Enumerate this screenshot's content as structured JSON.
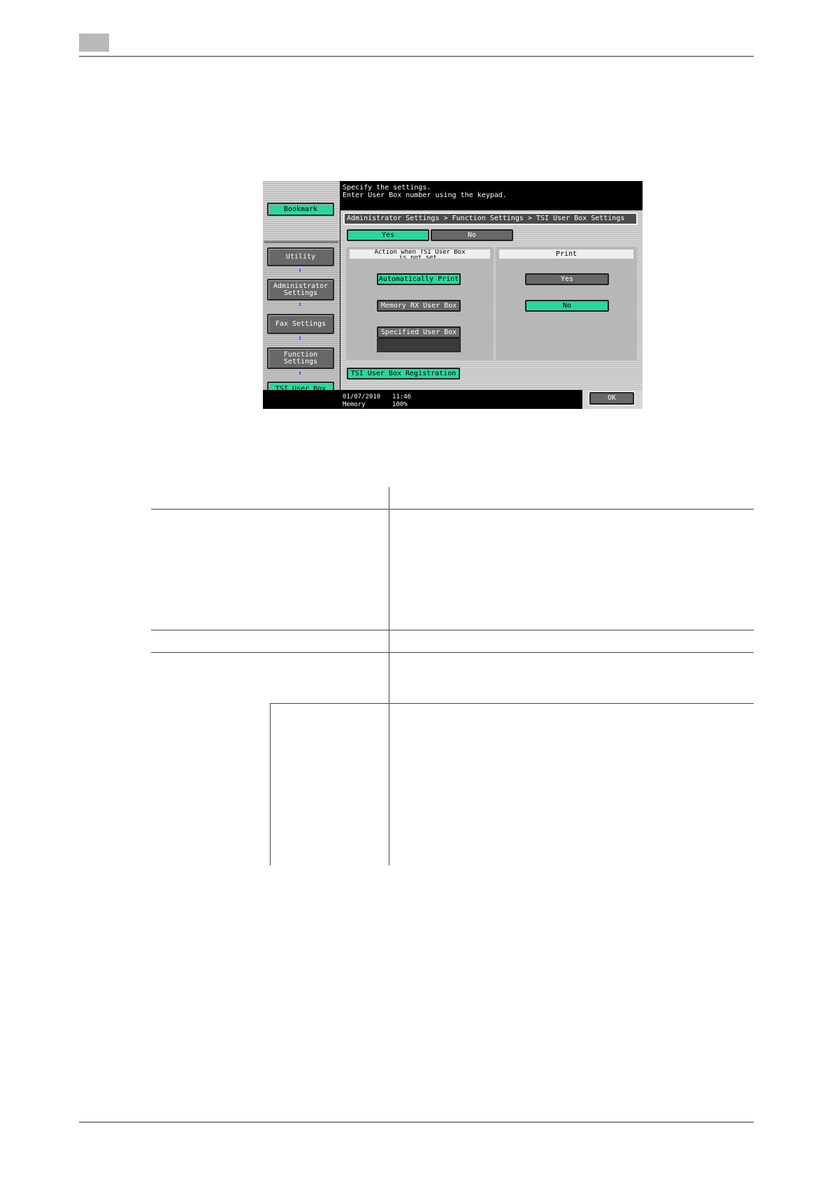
{
  "screen": {
    "sidebar": {
      "bookmark_label": "Bookmark",
      "items": [
        {
          "label": "Utility"
        },
        {
          "label": "Administrator\nSettings"
        },
        {
          "label": "Fax Settings"
        },
        {
          "label": "Function\nSettings"
        },
        {
          "label": "TSI User Box\nSettings"
        }
      ],
      "arrow_glyph": "⬇"
    },
    "message": "Specify the settings.\nEnter User Box number using the keypad.",
    "breadcrumb": "Administrator Settings > Function Settings > TSI User Box Settings",
    "toggle": {
      "yes_label": "Yes",
      "no_label": "No",
      "selected": "Yes"
    },
    "action_panel": {
      "header": "Action when TSI User Box\nis not set.",
      "options": [
        "Automatically Print",
        "Memory RX User Box",
        "Specified User Box"
      ],
      "selected": "Automatically Print",
      "specified_box_value": ""
    },
    "print_panel": {
      "header": "Print",
      "options": [
        "Yes",
        "No"
      ],
      "selected": "No"
    },
    "registration_label": "TSI User Box Registration",
    "status": {
      "date": "01/07/2010",
      "time": "11:46",
      "memory_label": "Memory",
      "memory_value": "100%"
    },
    "ok_label": "OK",
    "colors": {
      "selected": "#35e8ad",
      "unselected": "#6a6a6a",
      "arrow": "#1a55ff"
    }
  }
}
